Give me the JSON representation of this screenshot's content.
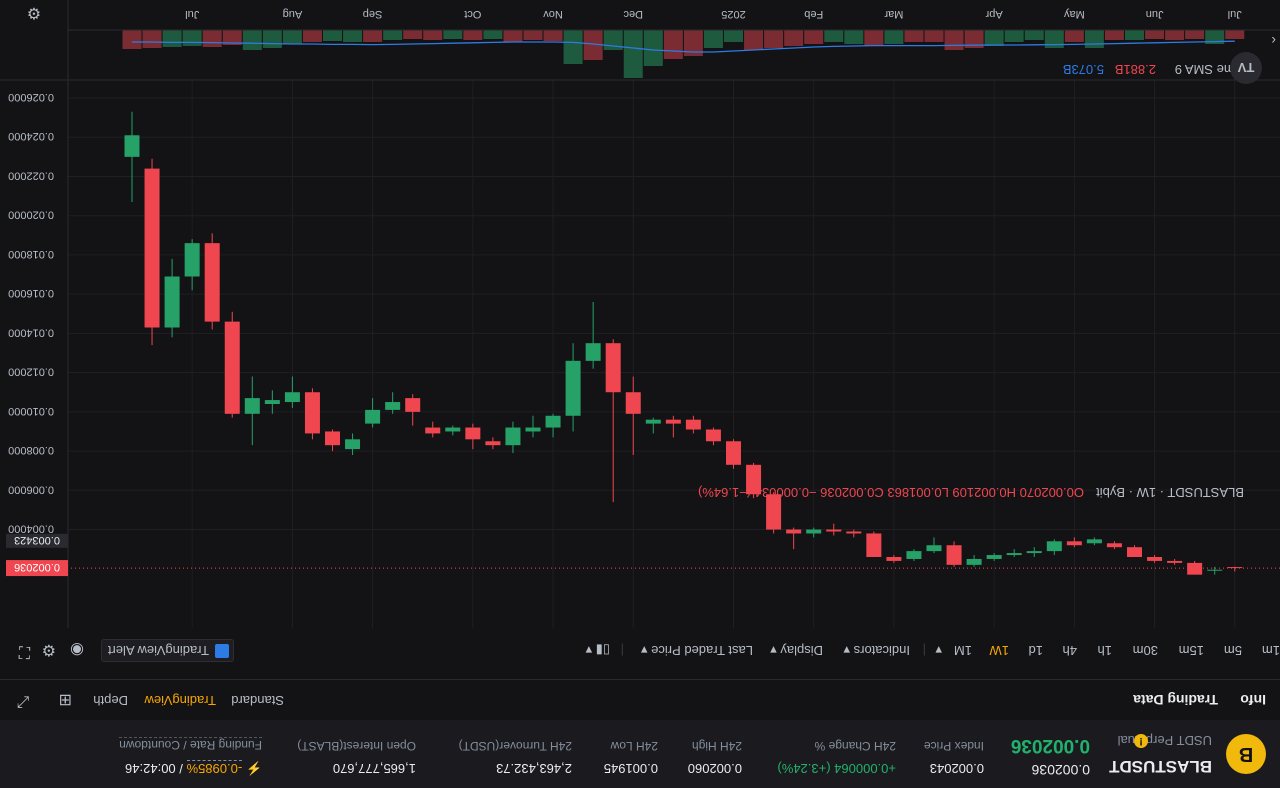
{
  "symbol": {
    "name": "BLASTUSDT",
    "sub": "USDT Perpetual",
    "logo": "B",
    "warn": "!",
    "price": "0.002036"
  },
  "stats": [
    {
      "value": "0.002036",
      "label": "",
      "color": "#eaecef"
    },
    {
      "value": "0.002043",
      "label": "Index Price",
      "color": "#eaecef"
    },
    {
      "value": "+0.000064 (+3.24%)",
      "label": "24H Change %",
      "color": "#20b26c"
    },
    {
      "value": "0.002060",
      "label": "24H High",
      "color": "#eaecef"
    },
    {
      "value": "0.001945",
      "label": "24H Low",
      "color": "#eaecef"
    },
    {
      "value": "2,463,432.73",
      "label": "24H Turnover(USDT)",
      "color": "#eaecef"
    },
    {
      "value": "1,665,777,670",
      "label": "Open Interest(BLAST)",
      "color": "#eaecef"
    },
    {
      "value": "-0.0985%",
      "label": "Funding Rate / Countdown",
      "color": "#f7a600"
    }
  ],
  "countdown": "/ 00:42:46",
  "tabs": {
    "left": [
      "Info",
      "Trading Data"
    ],
    "right": [
      "Standard",
      "TradingView",
      "Depth"
    ],
    "active": "TradingView"
  },
  "toolbar": {
    "intervals": [
      "1m",
      "5m",
      "15m",
      "30m",
      "1h",
      "4h",
      "1d",
      "1W",
      "1M"
    ],
    "active_interval": "1W",
    "indicators": "Indicators",
    "display": "Display",
    "last_price": "Last Traded Price",
    "alert": "TradingView Alert"
  },
  "legend": {
    "pair": "BLASTUSDT · 1W · Bybit",
    "ohlc": "O0.002070 H0.002109 L0.001863 C0.002036 −0.000034 (−1.64%)"
  },
  "volume_legend": {
    "label": "Volume SMA 9",
    "v1": "2.881B",
    "v2": "5.073B"
  },
  "colors": {
    "up": "#26a269",
    "down": "#f0464f",
    "volume_sma": "#2d7be5",
    "accent": "#f7a600"
  },
  "chart_data": {
    "type": "candlestick",
    "y_axis": {
      "inverted": true,
      "ylim": [
        0.001863,
        0.026
      ],
      "ticks": [
        "0.004000",
        "0.006000",
        "0.008000",
        "0.010000",
        "0.012000",
        "0.014000",
        "0.016000",
        "0.018000",
        "0.020000",
        "0.022000",
        "0.024000",
        "0.026000"
      ],
      "tick_values": [
        0.004,
        0.006,
        0.008,
        0.01,
        0.012,
        0.014,
        0.016,
        0.018,
        0.02,
        0.022,
        0.024,
        0.026
      ]
    },
    "x_axis": {
      "labels": [
        "Jul",
        "Aug",
        "Sep",
        "Oct",
        "Nov",
        "Dec",
        "2025",
        "Feb",
        "Mar",
        "Apr",
        "May",
        "Jun",
        "Jul"
      ],
      "label_index": [
        3,
        8,
        12,
        17,
        21,
        25,
        30,
        34,
        38,
        43,
        47,
        51,
        55
      ]
    },
    "last_price": 0.002036,
    "last_price_label": "0.002036",
    "marker_price": 0.003423,
    "marker_label": "0.003423",
    "candles": [
      {
        "o": 0.023,
        "c": 0.0241,
        "h": 0.0253,
        "l": 0.0207
      },
      {
        "o": 0.0224,
        "c": 0.0143,
        "h": 0.0229,
        "l": 0.0134
      },
      {
        "o": 0.0143,
        "c": 0.0169,
        "h": 0.0178,
        "l": 0.0138
      },
      {
        "o": 0.0169,
        "c": 0.0186,
        "h": 0.0188,
        "l": 0.0162
      },
      {
        "o": 0.0186,
        "c": 0.0146,
        "h": 0.0191,
        "l": 0.0142
      },
      {
        "o": 0.0146,
        "c": 0.0099,
        "h": 0.0151,
        "l": 0.0097
      },
      {
        "o": 0.0099,
        "c": 0.0107,
        "h": 0.0118,
        "l": 0.0083
      },
      {
        "o": 0.0104,
        "c": 0.0106,
        "h": 0.0111,
        "l": 0.0099
      },
      {
        "o": 0.0105,
        "c": 0.011,
        "h": 0.0118,
        "l": 0.0102
      },
      {
        "o": 0.011,
        "c": 0.0089,
        "h": 0.0112,
        "l": 0.0086
      },
      {
        "o": 0.009,
        "c": 0.0083,
        "h": 0.0091,
        "l": 0.008
      },
      {
        "o": 0.0081,
        "c": 0.0086,
        "h": 0.0089,
        "l": 0.0078
      },
      {
        "o": 0.0094,
        "c": 0.0101,
        "h": 0.0107,
        "l": 0.0092
      },
      {
        "o": 0.0101,
        "c": 0.0105,
        "h": 0.011,
        "l": 0.0099
      },
      {
        "o": 0.0107,
        "c": 0.01,
        "h": 0.0109,
        "l": 0.0093
      },
      {
        "o": 0.0092,
        "c": 0.0089,
        "h": 0.0095,
        "l": 0.0087
      },
      {
        "o": 0.009,
        "c": 0.0092,
        "h": 0.0093,
        "l": 0.0088
      },
      {
        "o": 0.0092,
        "c": 0.0086,
        "h": 0.0094,
        "l": 0.0081
      },
      {
        "o": 0.0085,
        "c": 0.0083,
        "h": 0.0087,
        "l": 0.0081
      },
      {
        "o": 0.0083,
        "c": 0.0092,
        "h": 0.0095,
        "l": 0.0079
      },
      {
        "o": 0.009,
        "c": 0.0092,
        "h": 0.0098,
        "l": 0.0087
      },
      {
        "o": 0.0092,
        "c": 0.0098,
        "h": 0.0099,
        "l": 0.0087
      },
      {
        "o": 0.0098,
        "c": 0.0126,
        "h": 0.0135,
        "l": 0.009
      },
      {
        "o": 0.0126,
        "c": 0.0135,
        "h": 0.0156,
        "l": 0.0122
      },
      {
        "o": 0.0135,
        "c": 0.011,
        "h": 0.0137,
        "l": 0.0054
      },
      {
        "o": 0.011,
        "c": 0.0099,
        "h": 0.0118,
        "l": 0.0078
      },
      {
        "o": 0.0094,
        "c": 0.0096,
        "h": 0.0097,
        "l": 0.0089
      },
      {
        "o": 0.0096,
        "c": 0.0094,
        "h": 0.0098,
        "l": 0.0087
      },
      {
        "o": 0.0096,
        "c": 0.0091,
        "h": 0.0098,
        "l": 0.0089
      },
      {
        "o": 0.0091,
        "c": 0.0085,
        "h": 0.0092,
        "l": 0.0083
      },
      {
        "o": 0.0085,
        "c": 0.0073,
        "h": 0.0086,
        "l": 0.0071
      },
      {
        "o": 0.0073,
        "c": 0.0058,
        "h": 0.0074,
        "l": 0.0056
      },
      {
        "o": 0.0058,
        "c": 0.004,
        "h": 0.0059,
        "l": 0.0038
      },
      {
        "o": 0.004,
        "c": 0.0038,
        "h": 0.0041,
        "l": 0.003
      },
      {
        "o": 0.0038,
        "c": 0.004,
        "h": 0.0041,
        "l": 0.0036
      },
      {
        "o": 0.004,
        "c": 0.0039,
        "h": 0.0043,
        "l": 0.0037
      },
      {
        "o": 0.0039,
        "c": 0.0038,
        "h": 0.004,
        "l": 0.0036
      },
      {
        "o": 0.0038,
        "c": 0.0026,
        "h": 0.0039,
        "l": 0.0026
      },
      {
        "o": 0.0026,
        "c": 0.0024,
        "h": 0.0027,
        "l": 0.0023
      },
      {
        "o": 0.0025,
        "c": 0.0029,
        "h": 0.003,
        "l": 0.0024
      },
      {
        "o": 0.0029,
        "c": 0.0032,
        "h": 0.0036,
        "l": 0.0028
      },
      {
        "o": 0.0032,
        "c": 0.0022,
        "h": 0.0034,
        "l": 0.0021
      },
      {
        "o": 0.0022,
        "c": 0.0025,
        "h": 0.0027,
        "l": 0.0021
      },
      {
        "o": 0.0025,
        "c": 0.0027,
        "h": 0.0028,
        "l": 0.0024
      },
      {
        "o": 0.0027,
        "c": 0.0028,
        "h": 0.003,
        "l": 0.0026
      },
      {
        "o": 0.0028,
        "c": 0.0029,
        "h": 0.0031,
        "l": 0.0026
      },
      {
        "o": 0.0029,
        "c": 0.0034,
        "h": 0.0035,
        "l": 0.0027
      },
      {
        "o": 0.0034,
        "c": 0.0032,
        "h": 0.0036,
        "l": 0.0031
      },
      {
        "o": 0.0033,
        "c": 0.0035,
        "h": 0.0036,
        "l": 0.0032
      },
      {
        "o": 0.0033,
        "c": 0.0031,
        "h": 0.0034,
        "l": 0.003
      },
      {
        "o": 0.0031,
        "c": 0.0026,
        "h": 0.0032,
        "l": 0.0026
      },
      {
        "o": 0.0026,
        "c": 0.0024,
        "h": 0.0027,
        "l": 0.0023
      },
      {
        "o": 0.0024,
        "c": 0.0023,
        "h": 0.0025,
        "l": 0.0022
      },
      {
        "o": 0.0023,
        "c": 0.0017,
        "h": 0.0024,
        "l": 0.0017
      },
      {
        "o": 0.0019,
        "c": 0.0019,
        "h": 0.0021,
        "l": 0.0017
      },
      {
        "o": 0.00207,
        "c": 0.002036,
        "h": 0.002109,
        "l": 0.001863
      }
    ],
    "volume": [
      {
        "v": 0.95,
        "up": false
      },
      {
        "v": 0.9,
        "up": false
      },
      {
        "v": 0.85,
        "up": true
      },
      {
        "v": 0.8,
        "up": true
      },
      {
        "v": 0.85,
        "up": false
      },
      {
        "v": 0.75,
        "up": false
      },
      {
        "v": 1.0,
        "up": true
      },
      {
        "v": 0.9,
        "up": true
      },
      {
        "v": 0.7,
        "up": true
      },
      {
        "v": 0.6,
        "up": false
      },
      {
        "v": 0.55,
        "up": true
      },
      {
        "v": 0.6,
        "up": true
      },
      {
        "v": 0.6,
        "up": false
      },
      {
        "v": 0.5,
        "up": true
      },
      {
        "v": 0.45,
        "up": false
      },
      {
        "v": 0.5,
        "up": false
      },
      {
        "v": 0.45,
        "up": true
      },
      {
        "v": 0.5,
        "up": false
      },
      {
        "v": 0.45,
        "up": true
      },
      {
        "v": 0.6,
        "up": false
      },
      {
        "v": 0.5,
        "up": false
      },
      {
        "v": 0.55,
        "up": false
      },
      {
        "v": 1.7,
        "up": true
      },
      {
        "v": 1.5,
        "up": false
      },
      {
        "v": 1.0,
        "up": true
      },
      {
        "v": 2.4,
        "up": true
      },
      {
        "v": 1.8,
        "up": true
      },
      {
        "v": 1.45,
        "up": false
      },
      {
        "v": 1.3,
        "up": false
      },
      {
        "v": 0.9,
        "up": true
      },
      {
        "v": 0.6,
        "up": true
      },
      {
        "v": 1.0,
        "up": false
      },
      {
        "v": 0.9,
        "up": false
      },
      {
        "v": 0.8,
        "up": false
      },
      {
        "v": 0.7,
        "up": false
      },
      {
        "v": 0.6,
        "up": true
      },
      {
        "v": 0.7,
        "up": true
      },
      {
        "v": 0.8,
        "up": false
      },
      {
        "v": 0.7,
        "up": true
      },
      {
        "v": 0.6,
        "up": false
      },
      {
        "v": 0.6,
        "up": false
      },
      {
        "v": 1.0,
        "up": false
      },
      {
        "v": 0.9,
        "up": false
      },
      {
        "v": 0.8,
        "up": true
      },
      {
        "v": 0.6,
        "up": true
      },
      {
        "v": 0.5,
        "up": true
      },
      {
        "v": 0.9,
        "up": true
      },
      {
        "v": 0.6,
        "up": false
      },
      {
        "v": 0.9,
        "up": true
      },
      {
        "v": 0.5,
        "up": false
      },
      {
        "v": 0.5,
        "up": true
      },
      {
        "v": 0.45,
        "up": false
      },
      {
        "v": 0.5,
        "up": false
      },
      {
        "v": 0.45,
        "up": false
      },
      {
        "v": 0.7,
        "up": true
      },
      {
        "v": 0.45,
        "up": false
      }
    ],
    "volume_sma": [
      0.6,
      0.6,
      0.62,
      0.62,
      0.63,
      0.65,
      0.66,
      0.68,
      0.7,
      0.7,
      0.72,
      0.72,
      0.73,
      0.72,
      0.7,
      0.68,
      0.66,
      0.64,
      0.62,
      0.6,
      0.6,
      0.6,
      0.62,
      0.7,
      0.8,
      0.9,
      1.0,
      1.05,
      1.1,
      1.1,
      1.05,
      1.0,
      0.95,
      0.9,
      0.85,
      0.82,
      0.8,
      0.78,
      0.78,
      0.78,
      0.78,
      0.77,
      0.76,
      0.75,
      0.75,
      0.74,
      0.73,
      0.72,
      0.7,
      0.68,
      0.66,
      0.64,
      0.62,
      0.6,
      0.58,
      0.56
    ]
  }
}
